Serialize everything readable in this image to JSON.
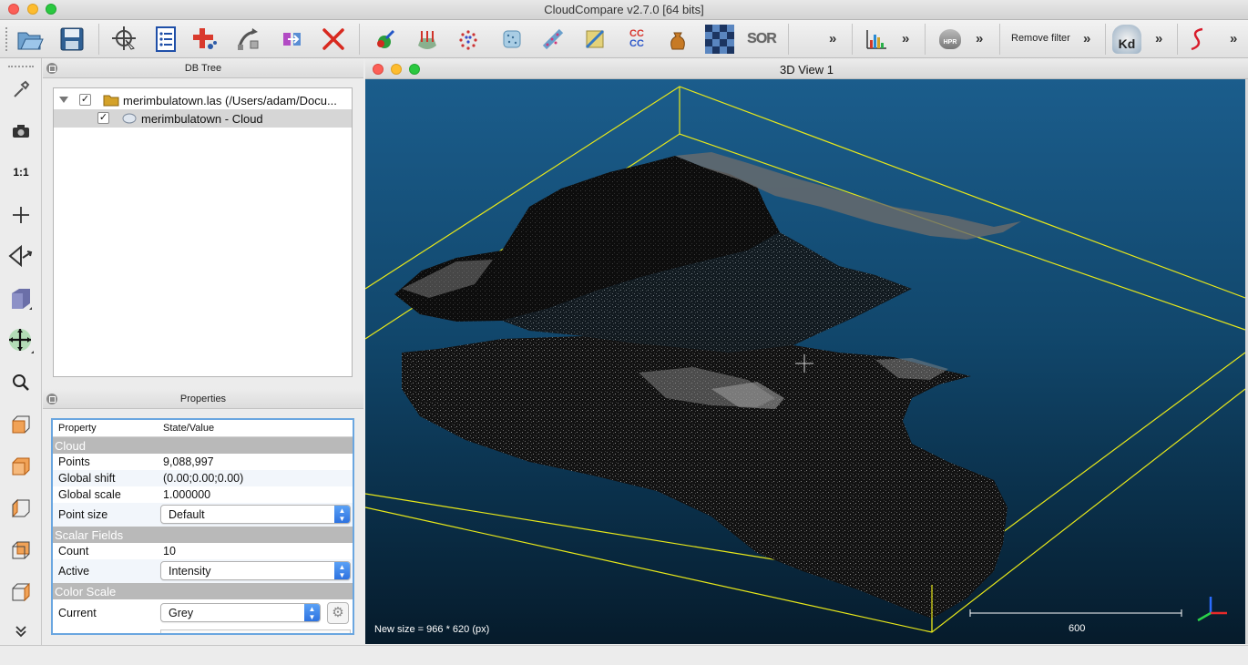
{
  "window": {
    "title": "CloudCompare v2.7.0 [64 bits]"
  },
  "toolbar": {
    "remove_filter_label": "Remove filter",
    "sor_label": "SOR",
    "cc_label_top": "CC",
    "cc_label_bottom": "CC",
    "hpr_label": "HPR",
    "kd_label": "Kd",
    "more_label": "»"
  },
  "left_toolbar": {
    "one_to_one_label": "1:1"
  },
  "db_tree": {
    "title": "DB Tree",
    "items": [
      {
        "label": "merimbulatown.las (/Users/adam/Docu...",
        "checked": "✓"
      },
      {
        "label": "merimbulatown - Cloud",
        "checked": "✓"
      }
    ]
  },
  "properties": {
    "title": "Properties",
    "col_property": "Property",
    "col_state": "State/Value",
    "section_cloud": "Cloud",
    "rows_cloud": [
      {
        "key": "Points",
        "value": "9,088,997"
      },
      {
        "key": "Global shift",
        "value": "(0.00;0.00;0.00)"
      },
      {
        "key": "Global scale",
        "value": "1.000000"
      }
    ],
    "point_size_label": "Point size",
    "point_size_value": "Default",
    "section_scalar": "Scalar Fields",
    "count_label": "Count",
    "count_value": "10",
    "active_label": "Active",
    "active_value": "Intensity",
    "section_color": "Color Scale",
    "current_label": "Current",
    "current_value": "Grey"
  },
  "view": {
    "title": "3D View 1",
    "size_message": "New size = 966 * 620 (px)",
    "scale_label": "600"
  },
  "colors": {
    "bbox": "#e8e81a",
    "view_top": "#1b5d8c",
    "view_bottom": "#061b2b",
    "selection": "#6aa6e0"
  }
}
